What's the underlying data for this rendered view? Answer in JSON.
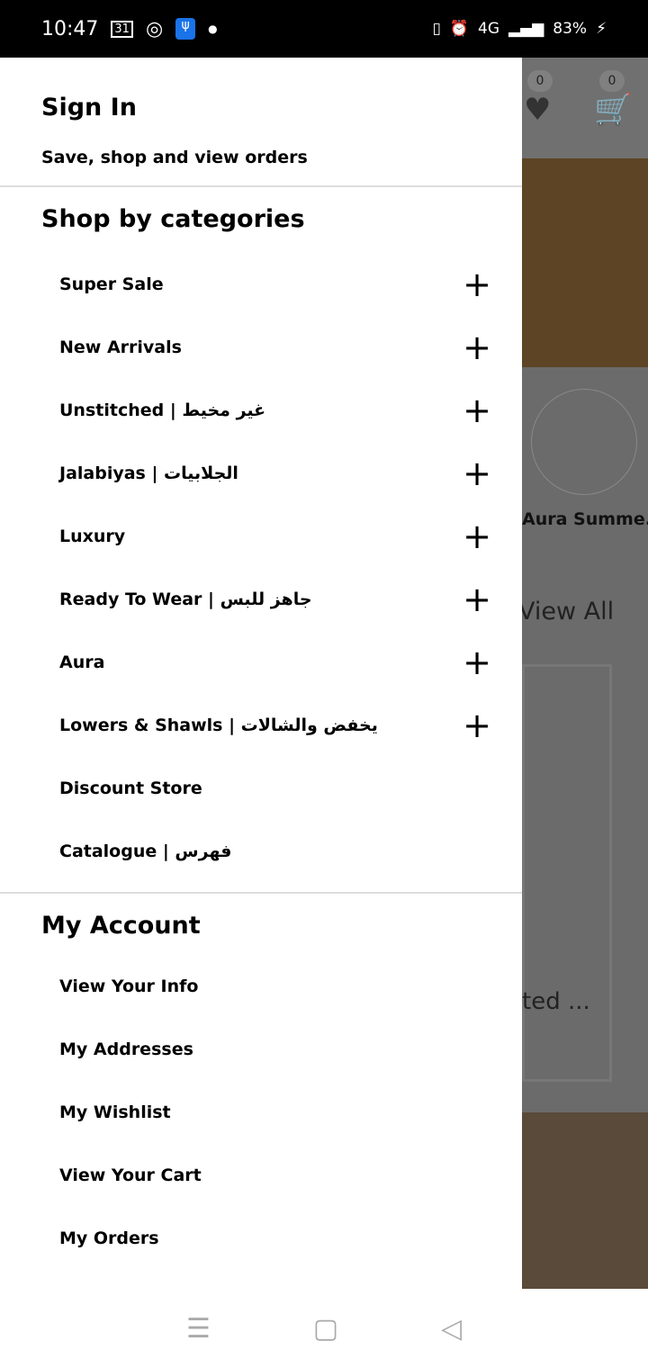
{
  "status_bar": {
    "time": "10:47",
    "calendar": "31",
    "battery": "83%",
    "network": "4G"
  },
  "drawer": {
    "sign_in": {
      "title": "Sign In",
      "subtitle": "Save, shop and view orders"
    },
    "categories": {
      "title": "Shop by categories",
      "items": [
        {
          "label": "Super Sale",
          "expandable": true
        },
        {
          "label": "New Arrivals",
          "expandable": true
        },
        {
          "label": "Unstitched | غير مخيط",
          "expandable": true
        },
        {
          "label": "Jalabiyas | الجلابيات",
          "expandable": true
        },
        {
          "label": "Luxury",
          "expandable": true
        },
        {
          "label": "Ready To Wear | جاهز للبس",
          "expandable": true
        },
        {
          "label": "Aura",
          "expandable": true
        },
        {
          "label": "Lowers & Shawls | يخفض والشالات",
          "expandable": true
        },
        {
          "label": "Discount Store",
          "expandable": false
        },
        {
          "label": "Catalogue | فهرس",
          "expandable": false
        }
      ]
    },
    "account": {
      "title": "My Account",
      "items": [
        "View Your Info",
        "My Addresses",
        "My Wishlist",
        "View Your Cart",
        "My Orders"
      ]
    }
  },
  "background": {
    "wishlist_count": "0",
    "cart_count": "0",
    "collection_label": "Aura Summe...",
    "view_all": "View All",
    "card_text": "ted ..."
  }
}
